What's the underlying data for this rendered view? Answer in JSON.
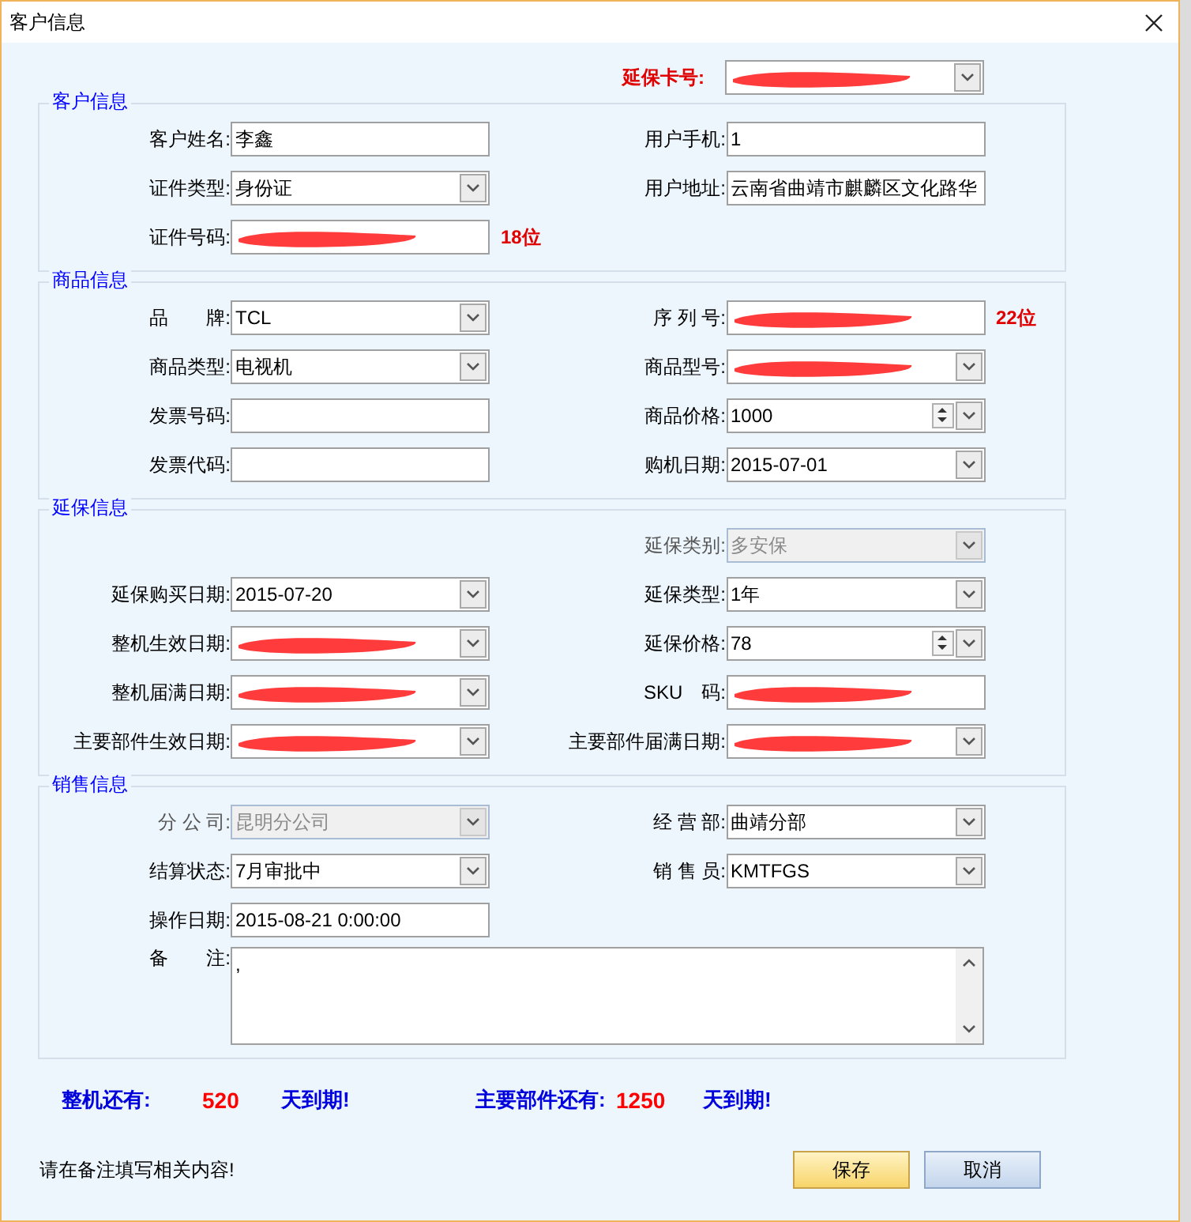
{
  "window": {
    "title": "客户信息"
  },
  "card_number": {
    "label": "延保卡号:",
    "kind": "combo",
    "disabled": false,
    "redacted": true
  },
  "groups": [
    {
      "title": "客户信息",
      "rows": [
        {
          "left": {
            "label": "客户姓名:",
            "kind": "text",
            "value": "李鑫",
            "disabled": false,
            "redacted": false
          },
          "right": {
            "label": "用户手机:",
            "kind": "text",
            "value": "1",
            "disabled": false,
            "redacted": false
          }
        },
        {
          "left": {
            "label": "证件类型:",
            "kind": "combo",
            "value": "身份证",
            "disabled": false,
            "redacted": false
          },
          "right": {
            "label": "用户地址:",
            "kind": "text",
            "value": "云南省曲靖市麒麟区文化路华",
            "disabled": false,
            "redacted": false
          }
        },
        {
          "left": {
            "label": "证件号码:",
            "kind": "text",
            "disabled": false,
            "redacted": true,
            "note": "18位"
          }
        }
      ]
    },
    {
      "title": "商品信息",
      "rows": [
        {
          "left": {
            "label": "品　　牌:",
            "kind": "combo",
            "value": "TCL",
            "disabled": false,
            "redacted": false
          },
          "right": {
            "label": "序 列 号:",
            "kind": "text",
            "disabled": false,
            "redacted": true,
            "note": "22位"
          }
        },
        {
          "left": {
            "label": "商品类型:",
            "kind": "combo",
            "value": "电视机",
            "disabled": false,
            "redacted": false
          },
          "right": {
            "label": "商品型号:",
            "kind": "combo",
            "disabled": false,
            "redacted": true
          }
        },
        {
          "left": {
            "label": "发票号码:",
            "kind": "text",
            "disabled": false,
            "redacted": false
          },
          "right": {
            "label": "商品价格:",
            "kind": "spin",
            "value": "1000",
            "disabled": false,
            "redacted": false
          }
        },
        {
          "left": {
            "label": "发票代码:",
            "kind": "text",
            "disabled": false,
            "redacted": false
          },
          "right": {
            "label": "购机日期:",
            "kind": "combo",
            "value": "2015-07-01",
            "disabled": false,
            "redacted": false
          }
        }
      ]
    },
    {
      "title": "延保信息",
      "rows": [
        {
          "right": {
            "label": "延保类别:",
            "kind": "combo",
            "value": "多安保",
            "disabled": true,
            "redacted": false
          }
        },
        {
          "left": {
            "label": "延保购买日期:",
            "kind": "combo",
            "value": "2015-07-20",
            "disabled": false,
            "redacted": false
          },
          "right": {
            "label": "延保类型:",
            "kind": "combo",
            "value": "1年",
            "disabled": false,
            "redacted": false
          }
        },
        {
          "left": {
            "label": "整机生效日期:",
            "kind": "combo",
            "disabled": false,
            "redacted": true
          },
          "right": {
            "label": "延保价格:",
            "kind": "spin",
            "value": "78",
            "disabled": false,
            "redacted": false
          }
        },
        {
          "left": {
            "label": "整机届满日期:",
            "kind": "combo",
            "disabled": false,
            "redacted": true
          },
          "right": {
            "label": "SKU　码:",
            "kind": "text",
            "disabled": false,
            "redacted": true
          }
        },
        {
          "left": {
            "label": "主要部件生效日期:",
            "kind": "combo",
            "disabled": false,
            "redacted": true
          },
          "right": {
            "label": "主要部件届满日期:",
            "kind": "combo",
            "disabled": false,
            "redacted": true
          }
        }
      ]
    },
    {
      "title": "销售信息",
      "rows": [
        {
          "left": {
            "label": "分 公 司:",
            "kind": "combo",
            "value": "昆明分公司",
            "disabled": true,
            "redacted": false
          },
          "right": {
            "label": "经 营 部:",
            "kind": "combo",
            "value": "曲靖分部",
            "disabled": false,
            "redacted": false
          }
        },
        {
          "left": {
            "label": "结算状态:",
            "kind": "combo",
            "value": "7月审批中",
            "disabled": false,
            "redacted": false
          },
          "right": {
            "label": "销 售 员:",
            "kind": "combo",
            "value": "KMTFGS",
            "disabled": false,
            "redacted": false
          }
        },
        {
          "left": {
            "label": "操作日期:",
            "kind": "text",
            "value": "2015-08-21 0:00:00",
            "disabled": false,
            "redacted": false
          }
        },
        {
          "left": {
            "label": "备　　注:",
            "kind": "textarea",
            "value": ",",
            "disabled": false,
            "redacted": false
          }
        }
      ]
    }
  ],
  "expiry": [
    {
      "label": "整机还有:",
      "count": "520",
      "suffix": "天到期!"
    },
    {
      "label": "主要部件还有:",
      "count": "1250",
      "suffix": "天到期!"
    }
  ],
  "hint": "请在备注填写相关内容!",
  "buttons": [
    {
      "label": "保存",
      "kind": "primary"
    },
    {
      "label": "取消",
      "kind": "secondary"
    }
  ]
}
